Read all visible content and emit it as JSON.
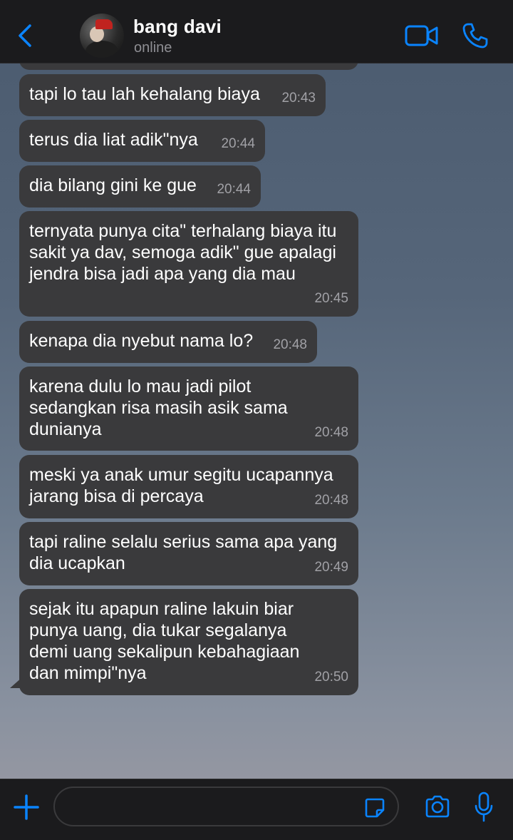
{
  "header": {
    "contact_name": "bang davi",
    "status": "online"
  },
  "icons": {
    "back": "chevron-left-icon",
    "video": "video-camera-icon",
    "call": "phone-icon",
    "plus": "plus-icon",
    "sticker": "sticker-icon",
    "camera": "camera-icon",
    "mic": "microphone-icon"
  },
  "colors": {
    "accent": "#0a84ff",
    "bubble": "#3a3a3c",
    "bar": "#1b1b1d"
  },
  "messages": [
    {
      "text": "tapi lo tau lah kehalang biaya",
      "time": "20:43"
    },
    {
      "text": "terus dia liat adik\"nya",
      "time": "20:44"
    },
    {
      "text": "dia bilang gini ke gue",
      "time": "20:44"
    },
    {
      "text": "ternyata punya cita\" terhalang biaya itu sakit ya dav, semoga adik\" gue apalagi jendra bisa jadi apa yang dia mau",
      "time": "20:45"
    },
    {
      "text": "kenapa dia nyebut nama lo?",
      "time": "20:48"
    },
    {
      "text": "karena dulu lo mau jadi pilot sedangkan risa masih asik sama dunianya",
      "time": "20:48"
    },
    {
      "text": "meski ya anak umur segitu ucapannya jarang bisa di percaya",
      "time": "20:48"
    },
    {
      "text": "tapi raline selalu serius sama apa yang dia ucapkan",
      "time": "20:49"
    },
    {
      "text": "sejak itu apapun raline lakuin biar punya uang, dia tukar segalanya demi uang sekalipun kebahagiaan dan mimpi\"nya",
      "time": "20:50"
    }
  ],
  "composer": {
    "value": "",
    "placeholder": ""
  }
}
